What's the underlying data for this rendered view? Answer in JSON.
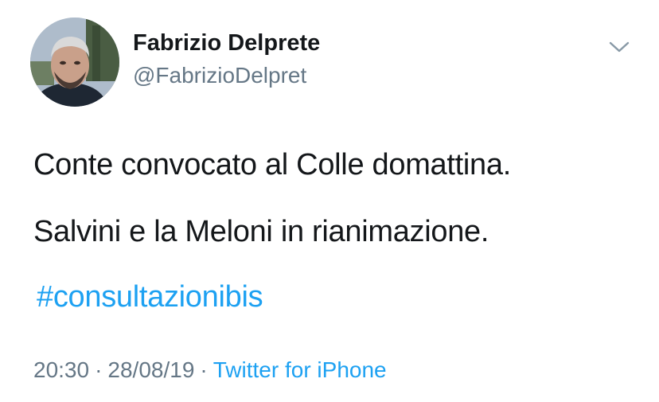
{
  "author": {
    "display_name": "Fabrizio Delprete",
    "handle": "@FabrizioDelpret",
    "avatar_icon": "profile-photo"
  },
  "tweet": {
    "lines": [
      "Conte convocato al Colle domattina.",
      "Salvini e la Meloni in rianimazione."
    ],
    "hashtag": "#consultazionibis"
  },
  "meta": {
    "time": "20:30",
    "separator": "·",
    "date": "28/08/19",
    "source": "Twitter for iPhone"
  },
  "icons": {
    "menu": "chevron-down-icon"
  },
  "colors": {
    "text": "#14171a",
    "secondary": "#657786",
    "link": "#1da1f2"
  }
}
